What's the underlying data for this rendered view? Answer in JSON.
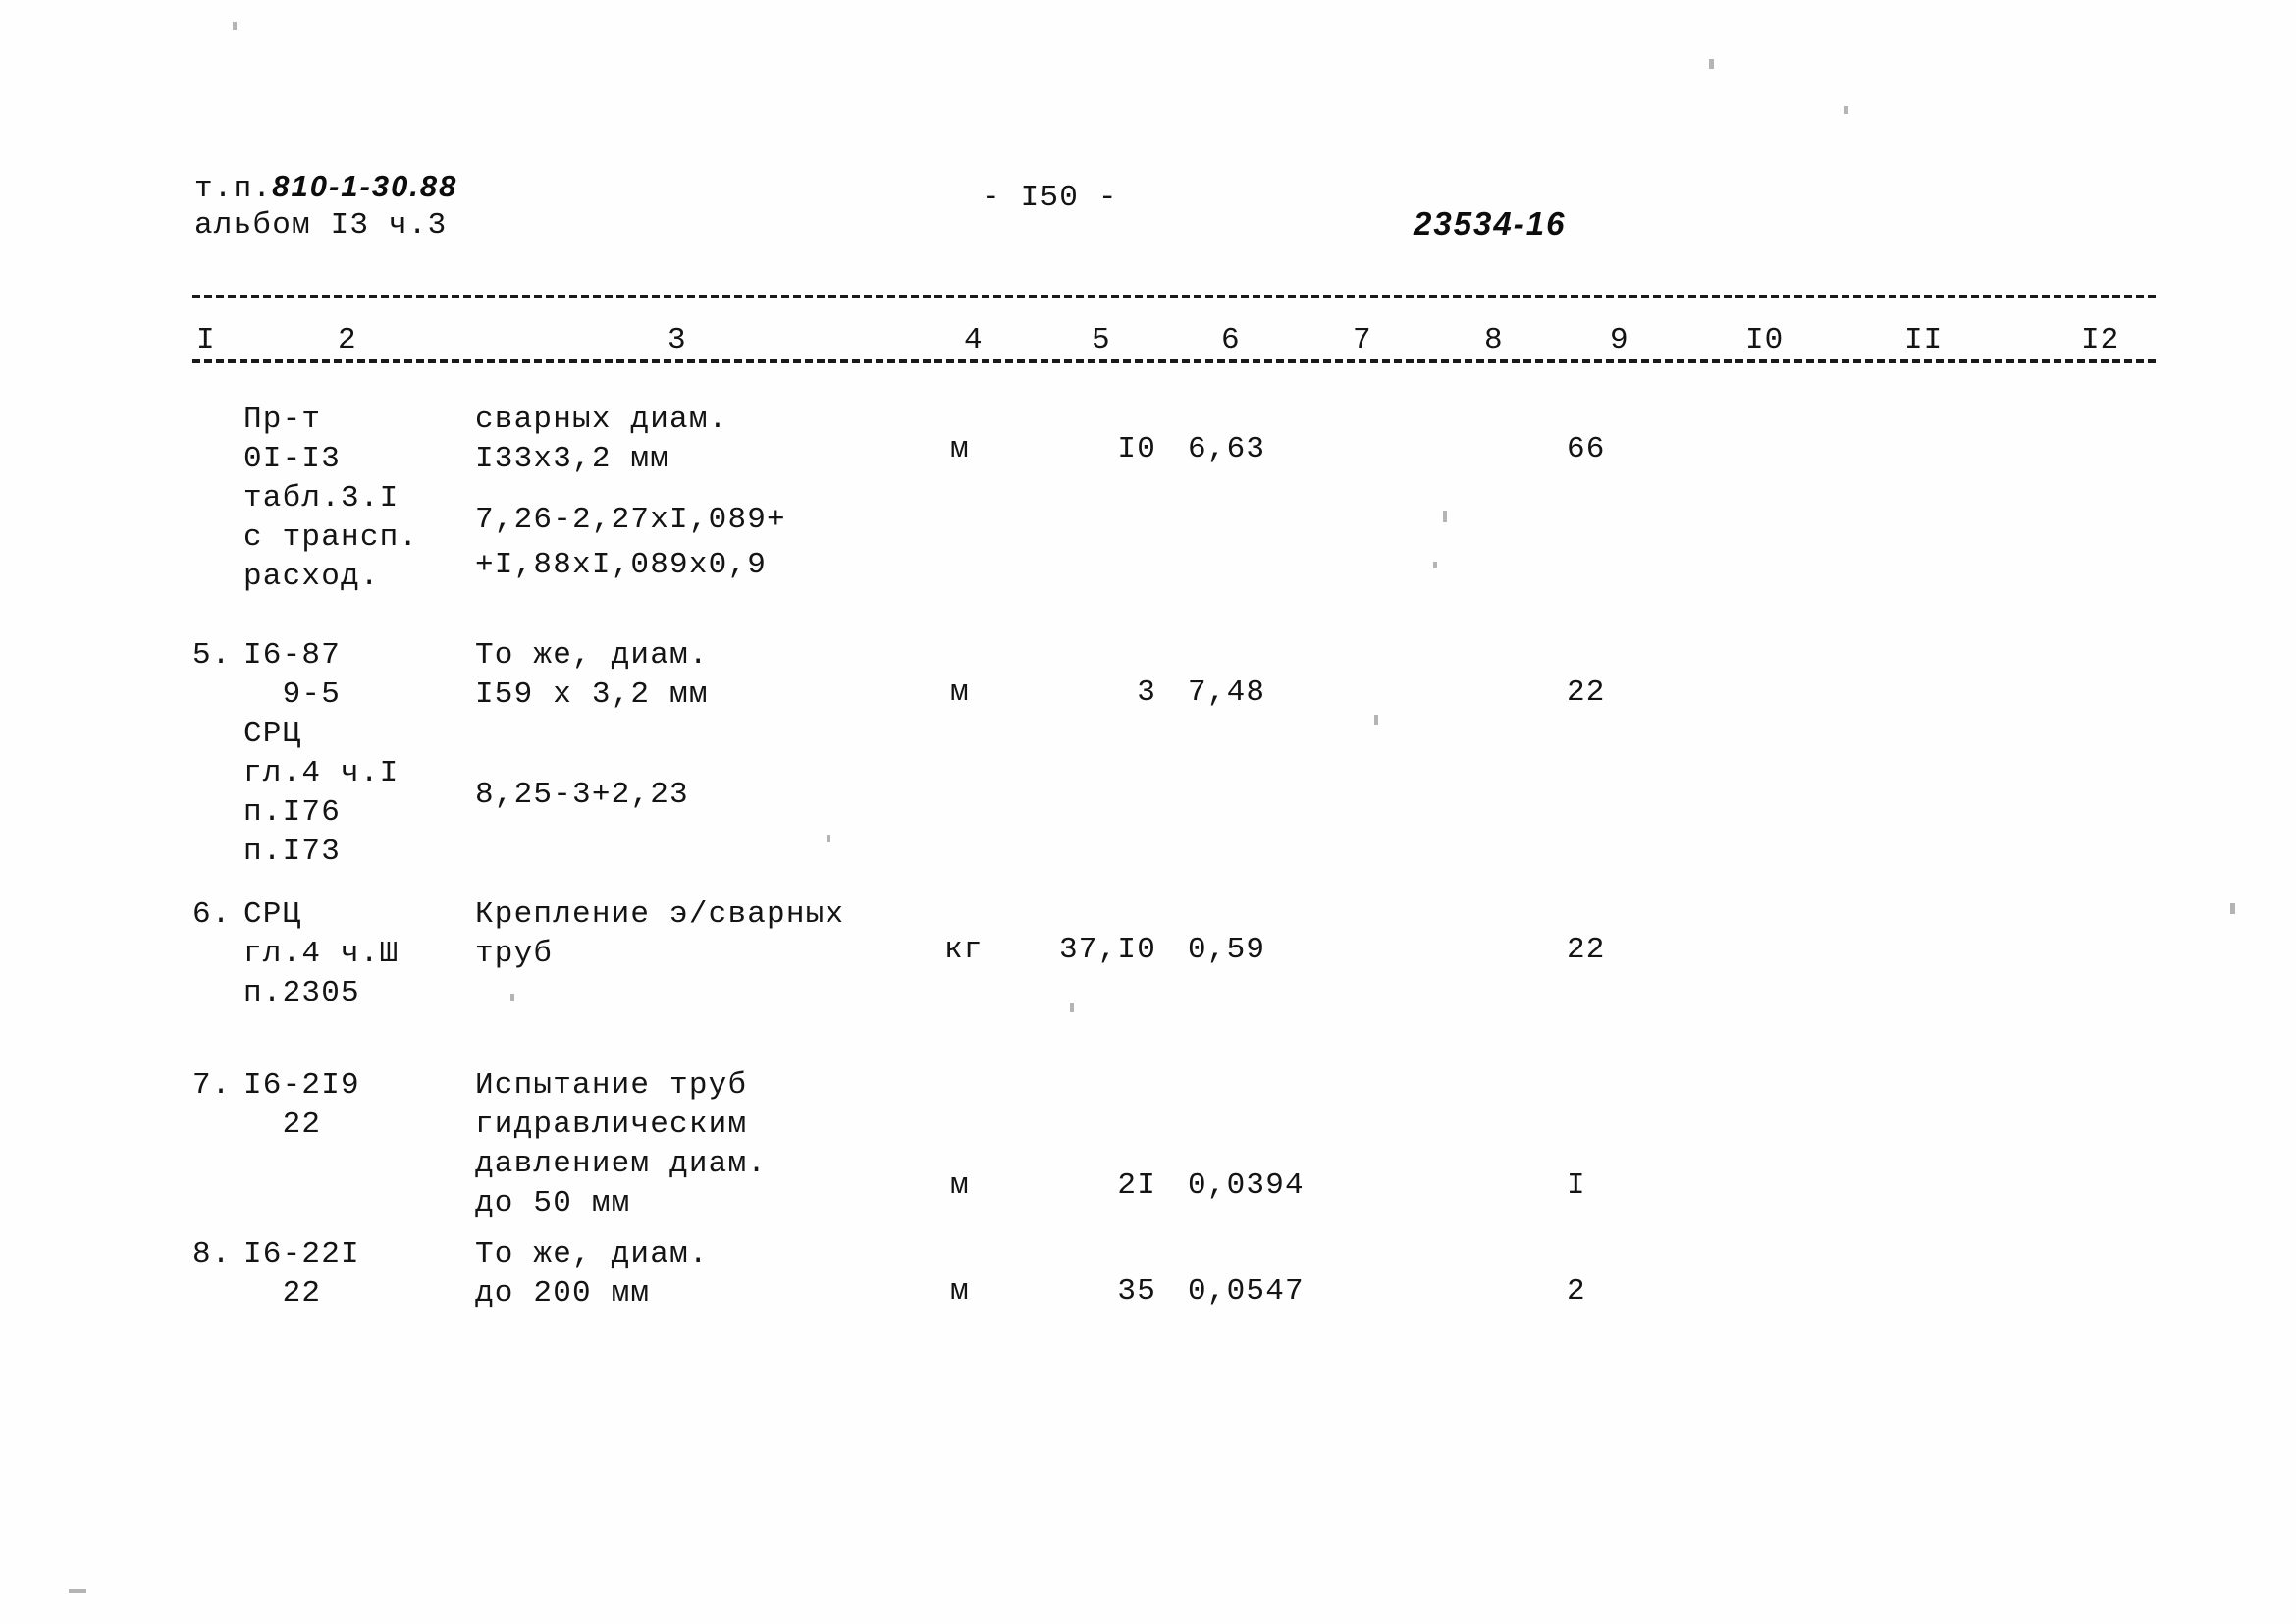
{
  "header": {
    "doc_prefix": "т.п.",
    "doc_code": "810-1-30.88",
    "album_line": "альбом I3 ч.3",
    "page_number": "- I50 -",
    "sheet_code": "23534-16"
  },
  "table": {
    "column_headers": [
      "I",
      "2",
      "3",
      "4",
      "5",
      "6",
      "7",
      "8",
      "9",
      "I0",
      "II",
      "I2"
    ],
    "rows": [
      {
        "number": "",
        "code": "Пр-т\n0I-I3\nтабл.3.I\nс трансп.\nрасход.",
        "description": "сварных диам.\nI33х3,2 мм",
        "formula_a": "7,26-2,27хI,089+",
        "formula_b": "+I,88хI,089х0,9",
        "unit": "м",
        "quantity": "I0",
        "rate": "6,63",
        "total": "66"
      },
      {
        "number": "5.",
        "code": "I6-87\n  9-5\nСРЦ\nгл.4 ч.I\nп.I76\nп.I73",
        "description": "То же, диам.\nI59 х 3,2 мм",
        "formula_a": "8,25-3+2,23",
        "formula_b": "",
        "unit": "м",
        "quantity": "3",
        "rate": "7,48",
        "total": "22"
      },
      {
        "number": "6.",
        "code": "СРЦ\nгл.4 ч.Ш\nп.2305",
        "description": "Крепление э/сварных\nтруб",
        "formula_a": "",
        "formula_b": "",
        "unit": "кг",
        "quantity": "37,I0",
        "rate": "0,59",
        "total": "22"
      },
      {
        "number": "7.",
        "code": "I6-2I9\n  22",
        "description": "Испытание труб\nгидравлическим\nдавлением диам.\nдо 50 мм",
        "formula_a": "",
        "formula_b": "",
        "unit": "м",
        "quantity": "2I",
        "rate": "0,0394",
        "total": "I"
      },
      {
        "number": "8.",
        "code": "I6-22I\n  22",
        "description": "То же, диам.\nдо 200 мм",
        "formula_a": "",
        "formula_b": "",
        "unit": "м",
        "quantity": "35",
        "rate": "0,0547",
        "total": "2"
      }
    ]
  }
}
